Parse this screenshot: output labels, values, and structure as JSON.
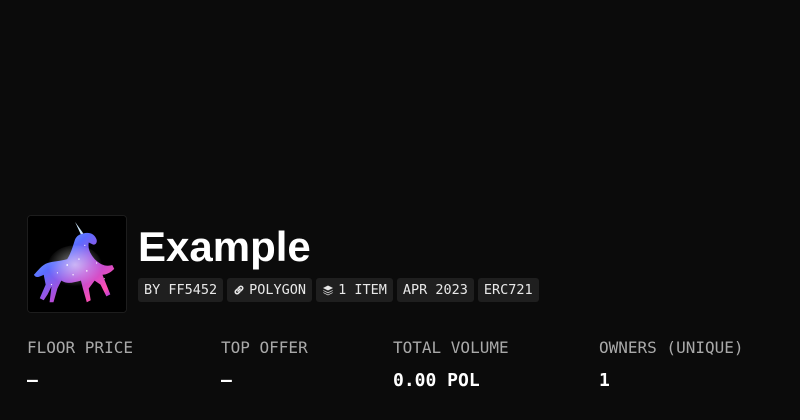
{
  "collection": {
    "title": "Example",
    "avatar_icon": "unicorn-galaxy-image"
  },
  "tags": {
    "creator": "BY FF5452",
    "chain": "POLYGON",
    "chain_icon": "link-icon",
    "items": "1 ITEM",
    "items_icon": "layers-icon",
    "date": "APR 2023",
    "standard": "ERC721"
  },
  "stats": {
    "floor_price": {
      "label": "FLOOR PRICE",
      "value": "—"
    },
    "top_offer": {
      "label": "TOP OFFER",
      "value": "—"
    },
    "total_volume": {
      "label": "TOTAL VOLUME",
      "value": "0.00 POL"
    },
    "owners": {
      "label": "OWNERS (UNIQUE)",
      "value": "1"
    }
  },
  "colors": {
    "background": "#0b0b0b",
    "tag_background": "#1f1f1f",
    "label_text": "#a9a9a9",
    "value_text": "#ffffff"
  }
}
